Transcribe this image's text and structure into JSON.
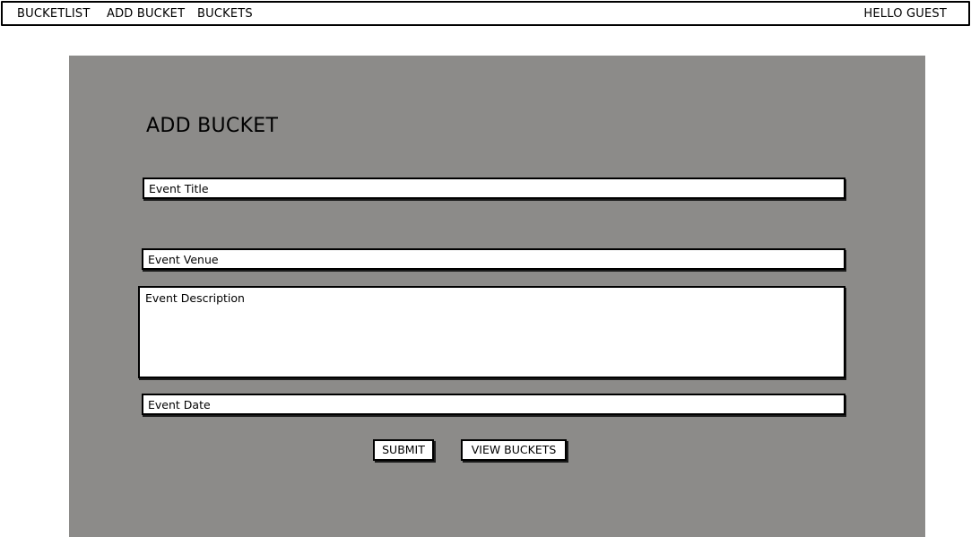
{
  "navbar": {
    "brand": "BUCKETLIST",
    "add_bucket": "ADD BUCKET",
    "buckets": "BUCKETS",
    "greeting": "HELLO GUEST"
  },
  "form": {
    "title": "ADD BUCKET",
    "event_title_placeholder": "Event Title",
    "event_venue_placeholder": "Event Venue",
    "event_description_placeholder": "Event Description",
    "event_date_placeholder": "Event Date",
    "submit_label": "SUBMIT",
    "view_buckets_label": "VIEW BUCKETS"
  },
  "colors": {
    "panel_background": "#8c8b89",
    "page_background": "#ffffff",
    "border": "#000000"
  }
}
